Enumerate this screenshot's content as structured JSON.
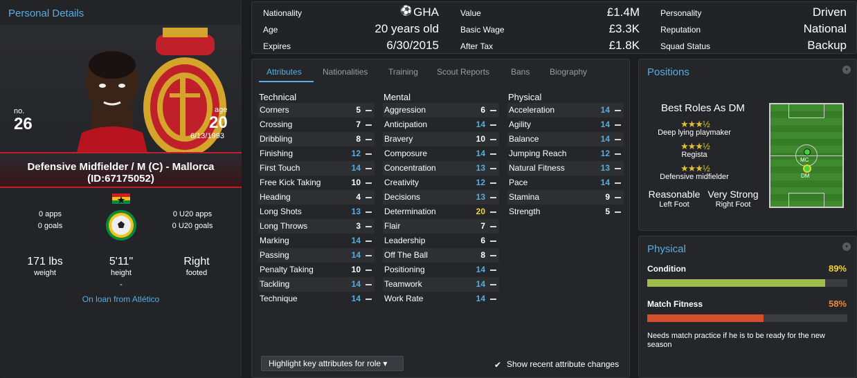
{
  "personal": {
    "title": "Personal Details",
    "no_label": "no.",
    "no": "26",
    "age_label": "age",
    "age": "20",
    "dob": "6/13/1993",
    "name_line": "Defensive Midfielder / M (C) - Mallorca",
    "id_line": "(ID:67175052)",
    "apps": "0 apps",
    "goals": "0 goals",
    "u20_apps": "0 U20 apps",
    "u20_goals": "0 U20 goals",
    "weight": "171 lbs",
    "weight_label": "weight",
    "height": "5'11\"",
    "height_label": "height",
    "height_sub": "-",
    "foot": "Right",
    "foot_label": "footed",
    "loan": "On loan from Atlético"
  },
  "info": {
    "nationality_label": "Nationality",
    "nationality": "GHA",
    "age_label": "Age",
    "age": "20 years old",
    "expires_label": "Expires",
    "expires": "6/30/2015",
    "value_label": "Value",
    "value": "£1.4M",
    "wage_label": "Basic Wage",
    "wage": "£3.3K",
    "aftertax_label": "After Tax",
    "aftertax": "£1.8K",
    "personality_label": "Personality",
    "personality": "Driven",
    "reputation_label": "Reputation",
    "reputation": "National",
    "squad_label": "Squad Status",
    "squad": "Backup"
  },
  "tabs": [
    "Attributes",
    "Nationalities",
    "Training",
    "Scout Reports",
    "Bans",
    "Biography"
  ],
  "attributes": {
    "technical_title": "Technical",
    "mental_title": "Mental",
    "physical_title": "Physical",
    "technical": [
      {
        "name": "Corners",
        "value": "5"
      },
      {
        "name": "Crossing",
        "value": "7"
      },
      {
        "name": "Dribbling",
        "value": "8"
      },
      {
        "name": "Finishing",
        "value": "12"
      },
      {
        "name": "First Touch",
        "value": "14"
      },
      {
        "name": "Free Kick Taking",
        "value": "10"
      },
      {
        "name": "Heading",
        "value": "4"
      },
      {
        "name": "Long Shots",
        "value": "13"
      },
      {
        "name": "Long Throws",
        "value": "3"
      },
      {
        "name": "Marking",
        "value": "14"
      },
      {
        "name": "Passing",
        "value": "14"
      },
      {
        "name": "Penalty Taking",
        "value": "10"
      },
      {
        "name": "Tackling",
        "value": "14"
      },
      {
        "name": "Technique",
        "value": "14"
      }
    ],
    "mental": [
      {
        "name": "Aggression",
        "value": "6"
      },
      {
        "name": "Anticipation",
        "value": "14"
      },
      {
        "name": "Bravery",
        "value": "10"
      },
      {
        "name": "Composure",
        "value": "14"
      },
      {
        "name": "Concentration",
        "value": "13"
      },
      {
        "name": "Creativity",
        "value": "12"
      },
      {
        "name": "Decisions",
        "value": "13"
      },
      {
        "name": "Determination",
        "value": "20"
      },
      {
        "name": "Flair",
        "value": "7"
      },
      {
        "name": "Leadership",
        "value": "6"
      },
      {
        "name": "Off The Ball",
        "value": "8"
      },
      {
        "name": "Positioning",
        "value": "14"
      },
      {
        "name": "Teamwork",
        "value": "14"
      },
      {
        "name": "Work Rate",
        "value": "14"
      }
    ],
    "physical": [
      {
        "name": "Acceleration",
        "value": "14"
      },
      {
        "name": "Agility",
        "value": "14"
      },
      {
        "name": "Balance",
        "value": "14"
      },
      {
        "name": "Jumping Reach",
        "value": "12"
      },
      {
        "name": "Natural Fitness",
        "value": "13"
      },
      {
        "name": "Pace",
        "value": "14"
      },
      {
        "name": "Stamina",
        "value": "9"
      },
      {
        "name": "Strength",
        "value": "5"
      }
    ],
    "highlight_button": "Highlight key attributes for role",
    "recent_changes": "Show recent attribute changes"
  },
  "colors": {
    "low": "#ffffff",
    "mid": "#4fb0e6",
    "high": "#f2d431"
  },
  "positions": {
    "title": "Positions",
    "best_roles": "Best Roles As DM",
    "roles": [
      {
        "stars": "★★★½",
        "name": "Deep lying playmaker"
      },
      {
        "stars": "★★★½",
        "name": "Regista"
      },
      {
        "stars": "★★★½",
        "name": "Defensive midfielder"
      }
    ],
    "left_foot": "Reasonable",
    "left_foot_label": "Left Foot",
    "right_foot": "Very Strong",
    "right_foot_label": "Right Foot",
    "pitch_mc": "MC",
    "pitch_dm": "DM"
  },
  "physical": {
    "title": "Physical",
    "condition_label": "Condition",
    "condition": "89%",
    "condition_value": 0.89,
    "fitness_label": "Match Fitness",
    "fitness": "58%",
    "fitness_value": 0.58,
    "note": "Needs match practice if he is to be ready for the new season"
  }
}
